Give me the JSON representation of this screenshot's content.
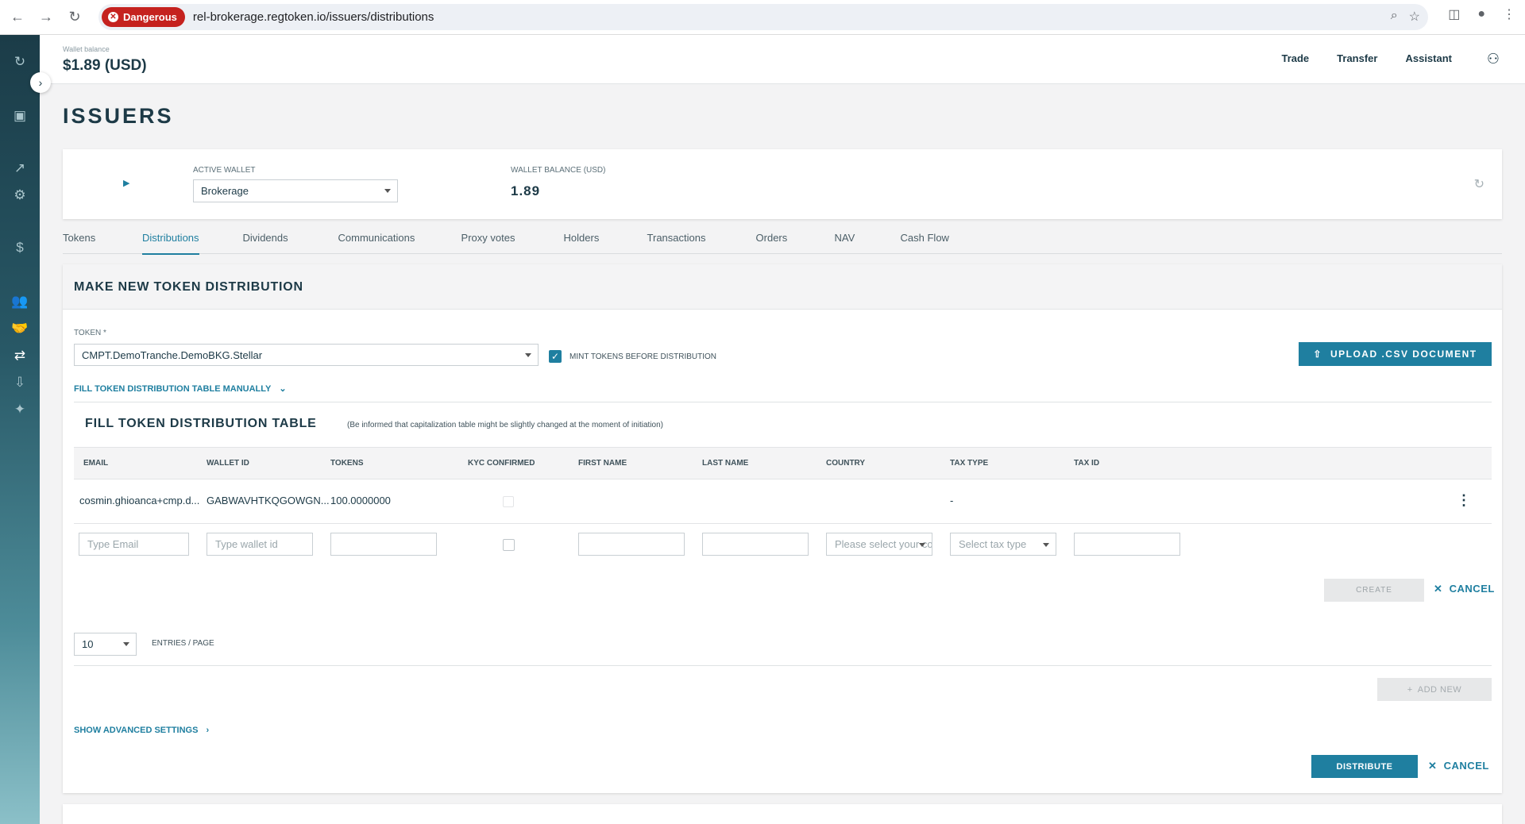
{
  "browser": {
    "back_icon": "←",
    "forward_icon": "→",
    "reload_icon": "↻",
    "security_label": "Dangerous",
    "url": "rel-brokerage.regtoken.io/issuers/distributions"
  },
  "header": {
    "wallet_balance_label": "Wallet balance",
    "wallet_balance_value": "$1.89 (USD)",
    "links": [
      "Trade",
      "Transfer",
      "Assistant"
    ]
  },
  "page": {
    "title": "ISSUERS"
  },
  "wallet_card": {
    "active_wallet_label": "ACTIVE WALLET",
    "active_wallet_value": "Brokerage",
    "wallet_balance_label": "WALLET BALANCE (USD)",
    "wallet_balance_value": "1.89"
  },
  "tabs": [
    "Tokens",
    "Distributions",
    "Dividends",
    "Communications",
    "Proxy votes",
    "Holders",
    "Transactions",
    "Orders",
    "NAV",
    "Cash Flow"
  ],
  "active_tab": "Distributions",
  "distribution": {
    "title": "MAKE NEW TOKEN DISTRIBUTION",
    "token_label": "TOKEN *",
    "token_value": "CMPT.DemoTranche.DemoBKG.Stellar",
    "mint_label": "MINT TOKENS BEFORE DISTRIBUTION",
    "mint_checked": true,
    "upload_label": "UPLOAD .CSV DOCUMENT",
    "fill_manually_label": "FILL TOKEN DISTRIBUTION TABLE MANUALLY",
    "table_title": "FILL TOKEN DISTRIBUTION TABLE",
    "table_note": "(Be informed that capitalization table might be slightly changed at the moment of initiation)",
    "columns": [
      "EMAIL",
      "WALLET ID",
      "TOKENS",
      "KYC CONFIRMED",
      "FIRST NAME",
      "LAST NAME",
      "COUNTRY",
      "TAX TYPE",
      "TAX ID"
    ],
    "rows": [
      {
        "email": "cosmin.ghioanca+cmp.d...",
        "wallet_id": "GABWAVHTKQGOWGN...",
        "tokens": "100.0000000",
        "kyc_confirmed": false,
        "first_name": "",
        "last_name": "",
        "country": "",
        "tax_type": "-",
        "tax_id": ""
      }
    ],
    "new_row": {
      "email_placeholder": "Type Email",
      "wallet_placeholder": "Type wallet id",
      "country_placeholder": "Please select your co",
      "tax_type_placeholder": "Select tax type"
    },
    "create_label": "CREATE",
    "cancel_label": "CANCEL",
    "per_page_value": "10",
    "per_page_label": "ENTRIES / PAGE",
    "add_new_label": "ADD NEW",
    "advanced_label": "SHOW ADVANCED SETTINGS",
    "distribute_label": "DISTRIBUTE",
    "cancel2_label": "CANCEL"
  },
  "colors": {
    "accent": "#1f7fa0",
    "text_dark": "#1d3a47",
    "danger": "#c5221f"
  }
}
